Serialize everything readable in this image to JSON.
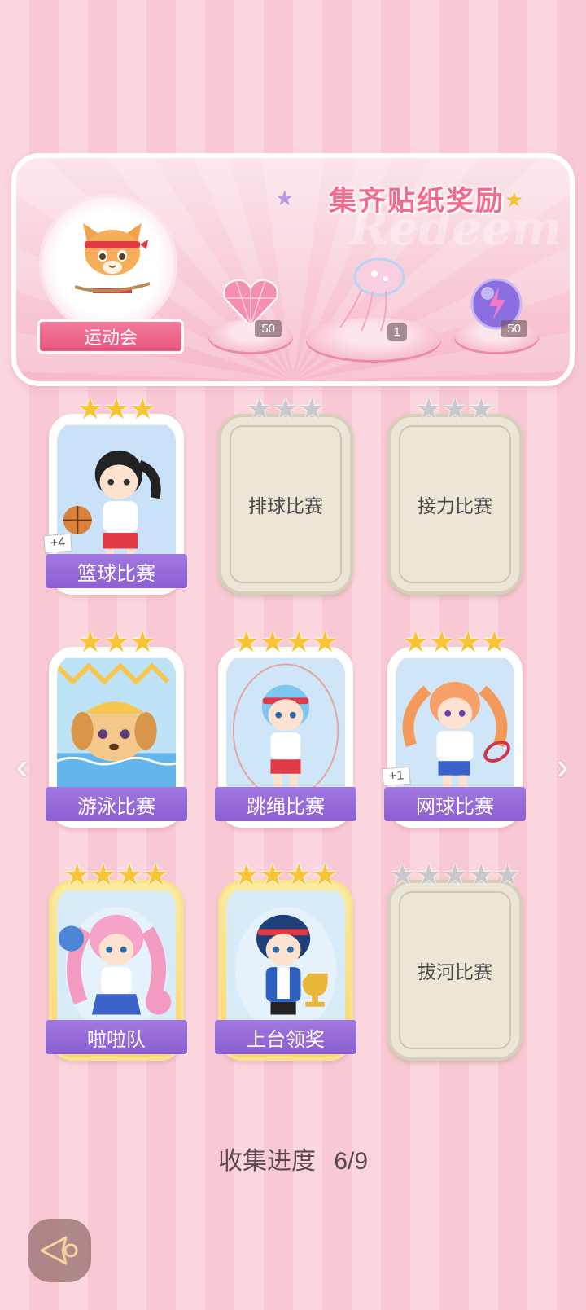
{
  "banner": {
    "title": "集齐贴纸奖励",
    "watermark": "Redeem",
    "event_label": "运动会",
    "rewards": [
      {
        "icon": "pink-heart-gem-icon",
        "count": "50"
      },
      {
        "icon": "jellyfish-ornament-icon",
        "count": "1"
      },
      {
        "icon": "purple-energy-orb-icon",
        "count": "50"
      }
    ]
  },
  "cards": [
    {
      "label": "篮球比赛",
      "stars_filled": 3,
      "stars_total": 3,
      "unlocked": true,
      "plus": "+4"
    },
    {
      "label": "排球比赛",
      "stars_filled": 0,
      "stars_total": 3,
      "unlocked": false
    },
    {
      "label": "接力比赛",
      "stars_filled": 0,
      "stars_total": 3,
      "unlocked": false
    },
    {
      "label": "游泳比赛",
      "stars_filled": 3,
      "stars_total": 3,
      "unlocked": true
    },
    {
      "label": "跳绳比赛",
      "stars_filled": 4,
      "stars_total": 4,
      "unlocked": true
    },
    {
      "label": "网球比赛",
      "stars_filled": 4,
      "stars_total": 4,
      "unlocked": true,
      "plus": "+1"
    },
    {
      "label": "啦啦队",
      "stars_filled": 4,
      "stars_total": 4,
      "unlocked": true,
      "gold": true
    },
    {
      "label": "上台领奖",
      "stars_filled": 4,
      "stars_total": 4,
      "unlocked": true,
      "gold": true
    },
    {
      "label": "拔河比赛",
      "stars_filled": 0,
      "stars_total": 5,
      "unlocked": false
    }
  ],
  "progress": {
    "label": "收集进度",
    "value": "6/9"
  },
  "nav": {
    "prev_icon": "chevron-left-icon",
    "next_icon": "chevron-right-icon"
  },
  "colors": {
    "accent_pink": "#f26b8d",
    "label_purple": "#8c5fd2",
    "star_gold": "#f7c534",
    "star_silver": "#c9c9cc"
  }
}
